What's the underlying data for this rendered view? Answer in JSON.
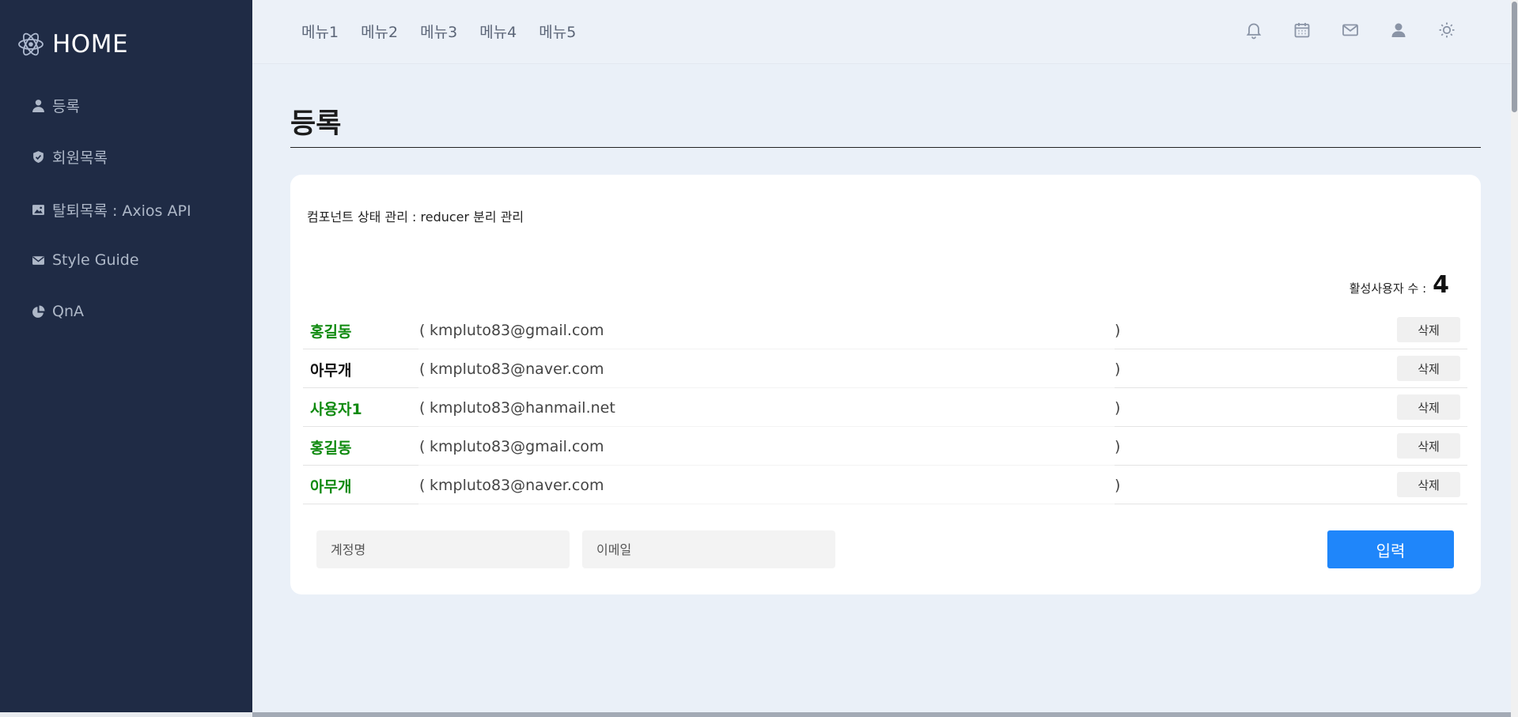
{
  "sidebar": {
    "logo_text": "HOME",
    "items": [
      {
        "label": "등록",
        "icon": "user-icon"
      },
      {
        "label": "회원목록",
        "icon": "shield-icon"
      },
      {
        "label": "탈퇴목록 : Axios API",
        "icon": "image-icon"
      },
      {
        "label": "Style Guide",
        "icon": "mail-icon"
      },
      {
        "label": "QnA",
        "icon": "pie-chart-icon"
      }
    ]
  },
  "header": {
    "menus": [
      "메뉴1",
      "메뉴2",
      "메뉴3",
      "메뉴4",
      "메뉴5"
    ],
    "icons": [
      "bell-icon",
      "calendar-icon",
      "envelope-icon",
      "user-icon",
      "sun-icon"
    ]
  },
  "main": {
    "title": "등록",
    "description": "컴포넌트 상태 관리 : reducer 분리 관리",
    "active_label": "활성사용자 수 :",
    "active_count": "4",
    "users": [
      {
        "name": "홍길동",
        "email": "kmpluto83@gmail.com",
        "active": true
      },
      {
        "name": "아무개",
        "email": "kmpluto83@naver.com",
        "active": false
      },
      {
        "name": "사용자1",
        "email": "kmpluto83@hanmail.net",
        "active": true
      },
      {
        "name": "홍길동",
        "email": "kmpluto83@gmail.com",
        "active": true
      },
      {
        "name": "아무개",
        "email": "kmpluto83@naver.com",
        "active": true
      }
    ],
    "open_paren": "(",
    "close_paren": ")",
    "delete_label": "삭제",
    "username_placeholder": "계정명",
    "email_placeholder": "이메일",
    "submit_label": "입력"
  },
  "colors": {
    "sidebar_bg": "#1f2b45",
    "active_name": "#0f8a0f",
    "inactive_name": "#111111",
    "primary": "#1f86fa"
  }
}
